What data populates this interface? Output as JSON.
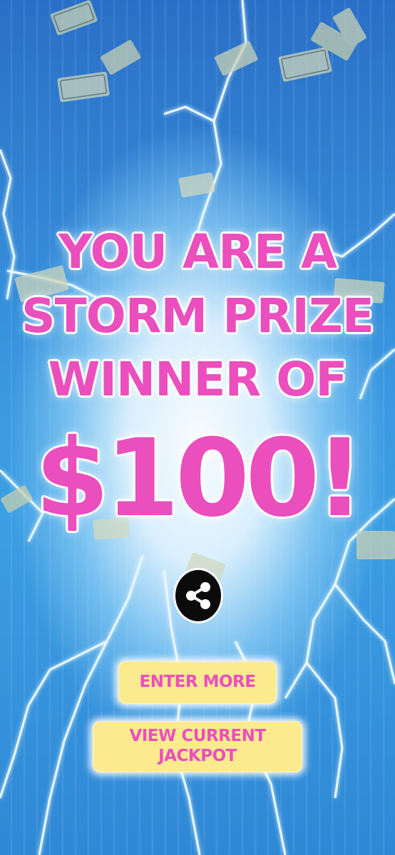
{
  "headline": {
    "line1": "YOU ARE A",
    "line2": "STORM PRIZE",
    "line3": "WINNER OF",
    "amount": "$100!"
  },
  "share": {
    "icon": "share-icon"
  },
  "buttons": {
    "enter_more": "ENTER MORE",
    "view_jackpot_line1": "VIEW CURRENT",
    "view_jackpot_line2": "JACKPOT"
  },
  "colors": {
    "headline": "#ea4fbd",
    "button_bg": "#fbea8e",
    "background": "#2f8fd8"
  }
}
